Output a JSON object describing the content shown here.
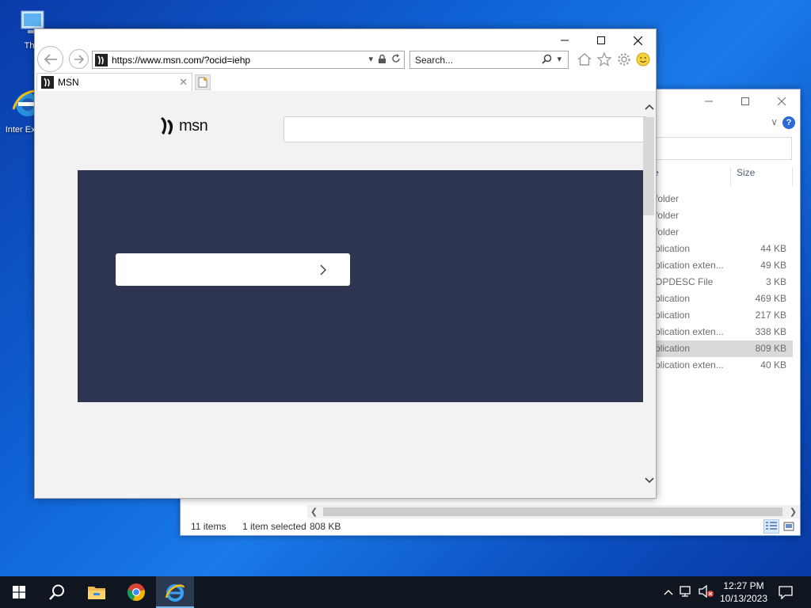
{
  "desktop": {
    "icons": [
      {
        "label": "This"
      },
      {
        "label": "Inter Explo"
      }
    ]
  },
  "explorer": {
    "column_size": "Size",
    "column_type_fragment": "e",
    "rows": [
      {
        "type": "folder",
        "size": ""
      },
      {
        "type": "folder",
        "size": ""
      },
      {
        "type": "folder",
        "size": ""
      },
      {
        "type": "plication",
        "size": "44 KB"
      },
      {
        "type": "plication exten...",
        "size": "49 KB"
      },
      {
        "type": "OPDESC File",
        "size": "3 KB"
      },
      {
        "type": "plication",
        "size": "469 KB"
      },
      {
        "type": "plication",
        "size": "217 KB"
      },
      {
        "type": "plication exten...",
        "size": "338 KB"
      },
      {
        "type": "plication",
        "size": "809 KB",
        "selected": true
      },
      {
        "type": "plication exten...",
        "size": "40 KB"
      }
    ],
    "status": {
      "items": "11 items",
      "selected": "1 item selected",
      "size": "808 KB"
    }
  },
  "ie": {
    "url": "https://www.msn.com/?ocid=iehp",
    "search_placeholder": "Search...",
    "tab_label": "MSN",
    "msn_word": "msn"
  },
  "taskbar": {
    "time": "12:27 PM",
    "date": "10/13/2023"
  },
  "colors": {
    "banner": "#2d3550",
    "taskbar": "#101620",
    "accent": "#76b9ed"
  }
}
